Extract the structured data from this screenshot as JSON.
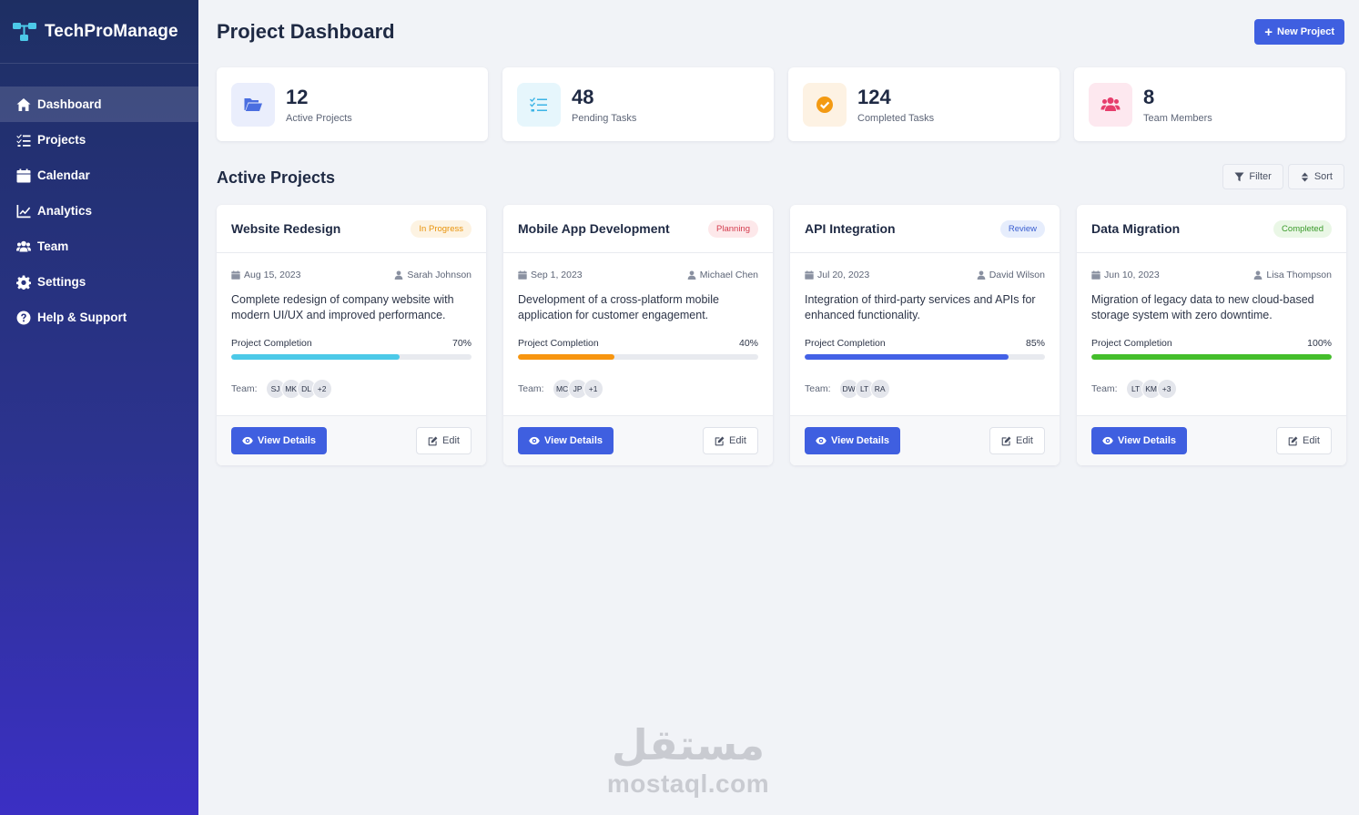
{
  "brand": {
    "name": "TechProManage"
  },
  "sidebar": {
    "items": [
      {
        "label": "Dashboard",
        "icon": "home-icon",
        "active": true
      },
      {
        "label": "Projects",
        "icon": "tasks-icon",
        "active": false
      },
      {
        "label": "Calendar",
        "icon": "calendar-icon",
        "active": false
      },
      {
        "label": "Analytics",
        "icon": "chart-line-icon",
        "active": false
      },
      {
        "label": "Team",
        "icon": "users-icon",
        "active": false
      },
      {
        "label": "Settings",
        "icon": "gear-icon",
        "active": false
      },
      {
        "label": "Help & Support",
        "icon": "question-circle-icon",
        "active": false
      }
    ]
  },
  "header": {
    "title": "Project Dashboard",
    "new_project_label": "New Project"
  },
  "stats": [
    {
      "value": "12",
      "label": "Active Projects",
      "icon": "folder-open-icon",
      "color": "#4a6ee0",
      "bg": "#eaeefc"
    },
    {
      "value": "48",
      "label": "Pending Tasks",
      "icon": "checklist-icon",
      "color": "#3cb4e6",
      "bg": "#e6f6fc"
    },
    {
      "value": "124",
      "label": "Completed Tasks",
      "icon": "check-circle-icon",
      "color": "#f39a12",
      "bg": "#fdf2e3"
    },
    {
      "value": "8",
      "label": "Team Members",
      "icon": "users-icon",
      "color": "#e63e6c",
      "bg": "#fde8ef"
    }
  ],
  "section": {
    "title": "Active Projects",
    "filter_label": "Filter",
    "sort_label": "Sort"
  },
  "projects": [
    {
      "name": "Website Redesign",
      "status": "In Progress",
      "status_color": "#e8930c",
      "status_bg": "#fdf3e2",
      "date": "Aug 15, 2023",
      "owner": "Sarah Johnson",
      "description": "Complete redesign of company website with modern UI/UX and improved performance.",
      "progress_label": "Project Completion",
      "progress": 70,
      "progress_text": "70%",
      "bar_color": "#4cc9e8",
      "team_label": "Team:",
      "team": [
        "SJ",
        "MK",
        "DL",
        "+2"
      ],
      "view_label": "View Details",
      "edit_label": "Edit"
    },
    {
      "name": "Mobile App Development",
      "status": "Planning",
      "status_color": "#d43c4e",
      "status_bg": "#fde8ea",
      "date": "Sep 1, 2023",
      "owner": "Michael Chen",
      "description": "Development of a cross-platform mobile application for customer engagement.",
      "progress_label": "Project Completion",
      "progress": 40,
      "progress_text": "40%",
      "bar_color": "#f7950f",
      "team_label": "Team:",
      "team": [
        "MC",
        "JP",
        "+1"
      ],
      "view_label": "View Details",
      "edit_label": "Edit"
    },
    {
      "name": "API Integration",
      "status": "Review",
      "status_color": "#3a5fd0",
      "status_bg": "#e6edfc",
      "date": "Jul 20, 2023",
      "owner": "David Wilson",
      "description": "Integration of third-party services and APIs for enhanced functionality.",
      "progress_label": "Project Completion",
      "progress": 85,
      "progress_text": "85%",
      "bar_color": "#4361e6",
      "team_label": "Team:",
      "team": [
        "DW",
        "LT",
        "RA"
      ],
      "view_label": "View Details",
      "edit_label": "Edit"
    },
    {
      "name": "Data Migration",
      "status": "Completed",
      "status_color": "#3a9a2a",
      "status_bg": "#eaf7e6",
      "date": "Jun 10, 2023",
      "owner": "Lisa Thompson",
      "description": "Migration of legacy data to new cloud-based storage system with zero downtime.",
      "progress_label": "Project Completion",
      "progress": 100,
      "progress_text": "100%",
      "bar_color": "#44be2b",
      "team_label": "Team:",
      "team": [
        "LT",
        "KM",
        "+3"
      ],
      "view_label": "View Details",
      "edit_label": "Edit"
    }
  ],
  "watermark": {
    "arabic": "مستقل",
    "latin": "mostaql.com"
  }
}
